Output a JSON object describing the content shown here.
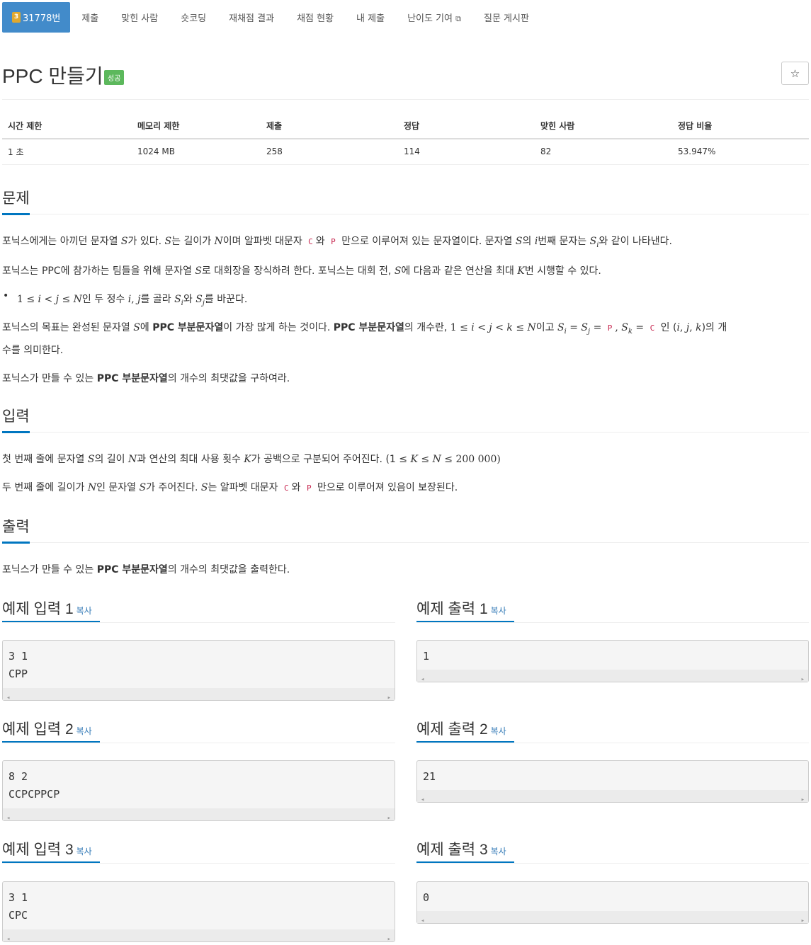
{
  "nav": {
    "active": {
      "badge": "3",
      "label": "31778번"
    },
    "items": [
      "제출",
      "맞힌 사람",
      "숏코딩",
      "재채점 결과",
      "채점 현황",
      "내 제출",
      "난이도 기여",
      "질문 게시판"
    ]
  },
  "problem": {
    "title": "PPC 만들기",
    "status": "성공",
    "star": "☆"
  },
  "stats": {
    "headers": [
      "시간 제한",
      "메모리 제한",
      "제출",
      "정답",
      "맞힌 사람",
      "정답 비율"
    ],
    "values": [
      "1 초",
      "1024 MB",
      "258",
      "114",
      "82",
      "53.947%"
    ]
  },
  "sections": {
    "problem": "문제",
    "input": "입력",
    "output": "출력"
  },
  "desc": {
    "p1": [
      "포닉스에게는 아끼던 문자열 ",
      "S",
      "가 있다. ",
      "S",
      "는 길이가 ",
      "N",
      "이며 알파벳 대문자 ",
      "C",
      "와 ",
      "P",
      " 만으로 이루어져 있는 문자열이다. 문자열 ",
      "S",
      "의 ",
      "i",
      "번째 문자는 ",
      "S",
      "i",
      "와 같이 나타낸다."
    ],
    "p2": [
      "포닉스는 PPC에 참가하는 팀들을 위해 문자열 ",
      "S",
      "로 대회장을 장식하려 한다. 포닉스는 대회 전, ",
      "S",
      "에 다음과 같은 연산을 최대 ",
      "K",
      "번 시행할 수 있다."
    ],
    "li": [
      "1 ≤ ",
      "i",
      " < ",
      "j",
      " ≤ ",
      "N",
      "인 두 정수 ",
      "i",
      ", ",
      "j",
      "를 골라 ",
      "S",
      "i",
      "와 ",
      "S",
      "j",
      "를 바꾼다."
    ],
    "p3a": [
      "포닉스의 목표는 완성된 문자열 ",
      "S",
      "에 ",
      "PPC 부분문자열",
      "이 가장 많게 하는 것이다. ",
      "PPC 부분문자열",
      "의 개수란, ",
      "1 ≤ ",
      "i",
      " < ",
      "j",
      " < ",
      "k",
      " ≤ ",
      "N",
      "이고 ",
      "S",
      "i",
      " = ",
      "S",
      "j",
      " = ",
      "P",
      ", ",
      "S",
      "k",
      " = ",
      "C",
      " 인 (",
      "i",
      ", ",
      "j",
      ", ",
      "k",
      ")의 개"
    ],
    "p3b": "수를 의미한다.",
    "p4": [
      "포닉스가 만들 수 있는 ",
      "PPC 부분문자열",
      "의 개수의 최댓값을 구하여라."
    ],
    "in1": [
      "첫 번째 줄에 문자열 ",
      "S",
      "의 길이 ",
      "N",
      "과 연산의 최대 사용 횟수 ",
      "K",
      "가 공백으로 구분되어 주어진다. (1 ≤ ",
      "K",
      " ≤ ",
      "N",
      " ≤ 200 000)"
    ],
    "in2": [
      "두 번째 줄에 길이가 ",
      "N",
      "인 문자열 ",
      "S",
      "가 주어진다. ",
      "S",
      "는 알파벳 대문자 ",
      "C",
      "와 ",
      "P",
      " 만으로 이루어져 있음이 보장된다."
    ],
    "out1": [
      "포닉스가 만들 수 있는 ",
      "PPC 부분문자열",
      "의 개수의 최댓값을 출력한다."
    ]
  },
  "samples": {
    "copy": "복사",
    "in_titles": [
      "예제 입력 1",
      "예제 입력 2",
      "예제 입력 3"
    ],
    "out_titles": [
      "예제 출력 1",
      "예제 출력 2",
      "예제 출력 3"
    ],
    "inputs": [
      "3 1\nCPP",
      "8 2\nCCPCPPCP",
      "3 1\nCPC"
    ],
    "outputs": [
      "1",
      "21",
      "0"
    ]
  }
}
